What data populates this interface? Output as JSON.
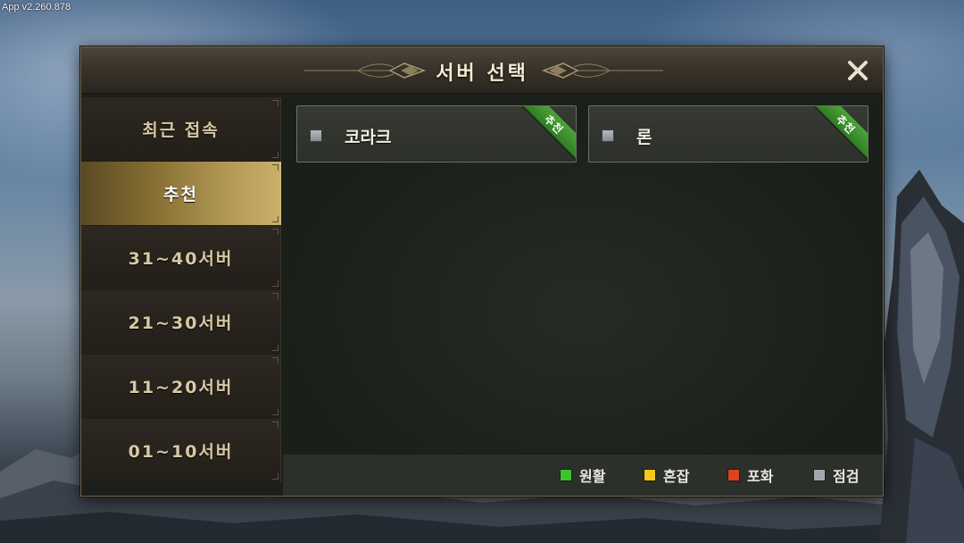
{
  "app": {
    "version": "App v2.260.878"
  },
  "dialog": {
    "title": "서버 선택",
    "close_icon": "close-x-icon"
  },
  "sidebar": {
    "items": [
      {
        "label": "최근 접속",
        "active": false
      },
      {
        "label": "추천",
        "active": true
      },
      {
        "label": "31~40서버",
        "active": false
      },
      {
        "label": "21~30서버",
        "active": false
      },
      {
        "label": "11~20서버",
        "active": false
      },
      {
        "label": "01~10서버",
        "active": false
      }
    ]
  },
  "servers": [
    {
      "name": "코라크",
      "badge": "추천",
      "status": "점검"
    },
    {
      "name": "론",
      "badge": "추천",
      "status": "점검"
    }
  ],
  "legend": {
    "items": [
      {
        "label": "원활",
        "color": "#3bc42a"
      },
      {
        "label": "혼잡",
        "color": "#f2c81c"
      },
      {
        "label": "포화",
        "color": "#e0421c"
      },
      {
        "label": "점검",
        "color": "#a3a8ae"
      }
    ]
  },
  "colors": {
    "accent_gold": "#b49a55",
    "badge_green": "#3f9530",
    "panel_bg": "#1c1f1b"
  }
}
